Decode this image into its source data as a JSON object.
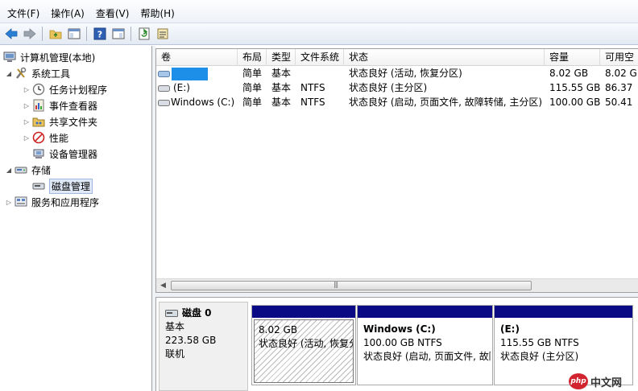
{
  "menubar": {
    "items": [
      "文件(F)",
      "操作(A)",
      "查看(V)",
      "帮助(H)"
    ]
  },
  "toolbar": {
    "buttons": [
      "back-arrow-icon",
      "forward-arrow-icon",
      "folder-up-icon",
      "show-hide-tree-icon",
      "help-icon",
      "panel-icon",
      "refresh-icon",
      "export-icon"
    ]
  },
  "tree": {
    "root": "计算机管理(本地)",
    "system_tools": "系统工具",
    "task_scheduler": "任务计划程序",
    "event_viewer": "事件查看器",
    "shared_folders": "共享文件夹",
    "performance": "性能",
    "device_manager": "设备管理器",
    "storage": "存储",
    "disk_management": "磁盘管理",
    "services": "服务和应用程序"
  },
  "volume_list": {
    "columns": [
      "卷",
      "布局",
      "类型",
      "文件系统",
      "状态",
      "容量",
      "可用空"
    ],
    "rows": [
      {
        "volume": "",
        "layout": "简单",
        "type": "基本",
        "fs": "",
        "status": "状态良好 (活动, 恢复分区)",
        "capacity": "8.02 GB",
        "free": "8.02 G"
      },
      {
        "volume": "(E:)",
        "layout": "简单",
        "type": "基本",
        "fs": "NTFS",
        "status": "状态良好 (主分区)",
        "capacity": "115.55 GB",
        "free": "86.37"
      },
      {
        "volume": "Windows (C:)",
        "layout": "简单",
        "type": "基本",
        "fs": "NTFS",
        "status": "状态良好 (启动, 页面文件, 故障转储, 主分区)",
        "capacity": "100.00 GB",
        "free": "50.41"
      }
    ],
    "scroll_left": "◀",
    "scroll_grip": "|||"
  },
  "disk_graph": {
    "disk_name": "磁盘 0",
    "disk_type": "基本",
    "disk_size": "223.58 GB",
    "disk_status": "联机",
    "partitions": [
      {
        "title": "",
        "size": "8.02 GB",
        "status": "状态良好 (活动, 恢复分区)"
      },
      {
        "title": "Windows  (C:)",
        "size": "100.00 GB NTFS",
        "status": "状态良好 (启动, 页面文件, 故障转储, 主分区)"
      },
      {
        "title": "(E:)",
        "size": "115.55 GB NTFS",
        "status": "状态良好 (主分区)"
      }
    ]
  },
  "watermark": {
    "logo": "php",
    "text": "中文网"
  },
  "colors": {
    "partition_bar": "#0a0a84",
    "selection": "#dfe8f6"
  }
}
